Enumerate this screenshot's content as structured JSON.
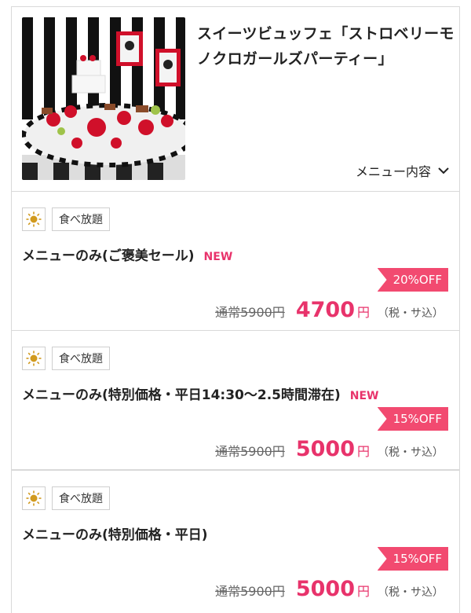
{
  "course": {
    "title": "スイーツビュッフェ「ストロベリーモノクロガールズパーティー」",
    "menu_toggle_label": "メニュー内容"
  },
  "menus": [
    {
      "tag": "食べ放題",
      "name": "メニューのみ(ご褒美セール)",
      "new_label": "NEW",
      "discount": "20%OFF",
      "regular_price": "通常5900円",
      "price": "4700",
      "yen": "円",
      "tax": "（税・サ込）"
    },
    {
      "tag": "食べ放題",
      "name": "メニューのみ(特別価格・平日14:30〜2.5時間滞在)",
      "new_label": "NEW",
      "discount": "15%OFF",
      "regular_price": "通常5900円",
      "price": "5000",
      "yen": "円",
      "tax": "（税・サ込）"
    },
    {
      "tag": "食べ放題",
      "name": "メニューのみ(特別価格・平日)",
      "discount": "15%OFF",
      "regular_price": "通常5900円",
      "price": "5000",
      "yen": "円",
      "tax": "（税・サ込）"
    }
  ],
  "icons": {
    "tag_icon": "sun-icon",
    "menu_toggle_icon": "chevron-down-icon"
  },
  "colors": {
    "accent": "#e8336b",
    "discount_bg": "#f24a70",
    "sun": "#d19a1e"
  }
}
